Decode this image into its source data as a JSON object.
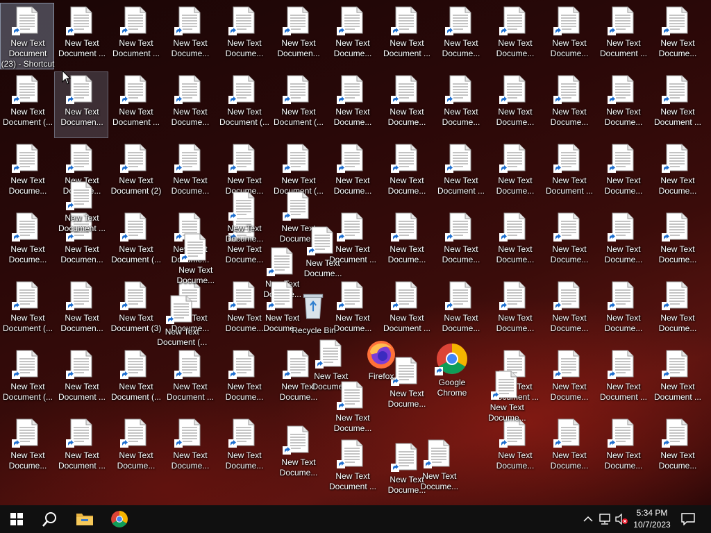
{
  "desktop": {
    "icons": [
      {
        "label": "New Text Document (23) - Shortcut",
        "col": 0,
        "row": 0,
        "selected": true
      },
      {
        "label": "New Text Document ...",
        "col": 1,
        "row": 0
      },
      {
        "label": "New Text Document ...",
        "col": 2,
        "row": 0
      },
      {
        "label": "New Text Docume...",
        "col": 3,
        "row": 0
      },
      {
        "label": "New Text Docume...",
        "col": 4,
        "row": 0
      },
      {
        "label": "New Text Documen...",
        "col": 5,
        "row": 0
      },
      {
        "label": "New Text Docume...",
        "col": 6,
        "row": 0
      },
      {
        "label": "New Text Document ...",
        "col": 7,
        "row": 0
      },
      {
        "label": "New Text Docume...",
        "col": 8,
        "row": 0
      },
      {
        "label": "New Text Docume...",
        "col": 9,
        "row": 0
      },
      {
        "label": "New Text Docume...",
        "col": 10,
        "row": 0
      },
      {
        "label": "New Text Document ...",
        "col": 11,
        "row": 0
      },
      {
        "label": "New Text Docume...",
        "col": 12,
        "row": 0
      },
      {
        "label": "New Text Document (...",
        "col": 0,
        "row": 1
      },
      {
        "label": "New Text Documen...",
        "col": 1,
        "row": 1,
        "hover": true
      },
      {
        "label": "New Text Document ...",
        "col": 2,
        "row": 1
      },
      {
        "label": "New Text Docume...",
        "col": 3,
        "row": 1
      },
      {
        "label": "New Text Document (...",
        "col": 4,
        "row": 1
      },
      {
        "label": "New Text Document (...",
        "col": 5,
        "row": 1
      },
      {
        "label": "New Text Docume...",
        "col": 6,
        "row": 1
      },
      {
        "label": "New Text Docume...",
        "col": 7,
        "row": 1
      },
      {
        "label": "New Text Docume...",
        "col": 8,
        "row": 1
      },
      {
        "label": "New Text Docume...",
        "col": 9,
        "row": 1
      },
      {
        "label": "New Text Docume...",
        "col": 10,
        "row": 1
      },
      {
        "label": "New Text Docume...",
        "col": 11,
        "row": 1
      },
      {
        "label": "New Text Document ...",
        "col": 12,
        "row": 1
      },
      {
        "label": "New Text Docume...",
        "col": 0,
        "row": 2
      },
      {
        "label": "New Text Docume...",
        "col": 1,
        "row": 2
      },
      {
        "label": "New Text Document (2)",
        "col": 2,
        "row": 2
      },
      {
        "label": "New Text Docume...",
        "col": 3,
        "row": 2
      },
      {
        "label": "New Text Docume...",
        "col": 4,
        "row": 2
      },
      {
        "label": "New Text Document (...",
        "col": 5,
        "row": 2
      },
      {
        "label": "New Text Docume...",
        "col": 6,
        "row": 2
      },
      {
        "label": "New Text Docume...",
        "col": 7,
        "row": 2
      },
      {
        "label": "New Text Document ...",
        "col": 8,
        "row": 2
      },
      {
        "label": "New Text Docume...",
        "col": 9,
        "row": 2
      },
      {
        "label": "New Text Document ...",
        "col": 10,
        "row": 2
      },
      {
        "label": "New Text Docume...",
        "col": 11,
        "row": 2
      },
      {
        "label": "New Text Docume...",
        "col": 12,
        "row": 2
      },
      {
        "label": "New Text Docume...",
        "col": 0,
        "row": 3
      },
      {
        "label": "New Text Documen...",
        "col": 1,
        "row": 3
      },
      {
        "label": "New Text Document (...",
        "col": 2,
        "row": 3
      },
      {
        "label": "New Text Docume...",
        "col": 3,
        "row": 3
      },
      {
        "label": "New Text Docume...",
        "col": 4,
        "row": 3
      },
      {
        "label": "New Text Document ...",
        "col": 6,
        "row": 3
      },
      {
        "label": "New Text Docume...",
        "col": 7,
        "row": 3
      },
      {
        "label": "New Text Docume...",
        "col": 8,
        "row": 3
      },
      {
        "label": "New Text Docume...",
        "col": 9,
        "row": 3
      },
      {
        "label": "New Text Docume...",
        "col": 10,
        "row": 3
      },
      {
        "label": "New Text Docume...",
        "col": 11,
        "row": 3
      },
      {
        "label": "New Text Docume...",
        "col": 12,
        "row": 3
      },
      {
        "label": "New Text Document (...",
        "col": 0,
        "row": 4
      },
      {
        "label": "New Text Documen...",
        "col": 1,
        "row": 4
      },
      {
        "label": "New Text Document (3)",
        "col": 2,
        "row": 4
      },
      {
        "label": "New Text Docume...",
        "col": 3,
        "row": 4
      },
      {
        "label": "New Text Docume...",
        "col": 4,
        "row": 4
      },
      {
        "label": "New Text Docume...",
        "col": 6,
        "row": 4
      },
      {
        "label": "New Text Document ...",
        "col": 7,
        "row": 4
      },
      {
        "label": "New Text Docume...",
        "col": 8,
        "row": 4
      },
      {
        "label": "New Text Docume...",
        "col": 9,
        "row": 4
      },
      {
        "label": "New Text Docume...",
        "col": 10,
        "row": 4
      },
      {
        "label": "New Text Docume...",
        "col": 11,
        "row": 4
      },
      {
        "label": "New Text Docume...",
        "col": 12,
        "row": 4
      },
      {
        "label": "New Text Document (...",
        "col": 0,
        "row": 5
      },
      {
        "label": "New Text Document ...",
        "col": 1,
        "row": 5
      },
      {
        "label": "New Text Document (...",
        "col": 2,
        "row": 5
      },
      {
        "label": "New Text Document ...",
        "col": 3,
        "row": 5
      },
      {
        "label": "New Text Docume...",
        "col": 4,
        "row": 5
      },
      {
        "label": "New Text Docume...",
        "col": 5,
        "row": 5
      },
      {
        "label": "New Text Document ...",
        "col": 9,
        "row": 5
      },
      {
        "label": "New Text Docume...",
        "col": 10,
        "row": 5
      },
      {
        "label": "New Text Document ...",
        "col": 11,
        "row": 5
      },
      {
        "label": "New Text Document ...",
        "col": 12,
        "row": 5
      },
      {
        "label": "New Text Docume...",
        "col": 0,
        "row": 6
      },
      {
        "label": "New Text Document ...",
        "col": 1,
        "row": 6
      },
      {
        "label": "New Text Docume...",
        "col": 2,
        "row": 6
      },
      {
        "label": "New Text Docume...",
        "col": 3,
        "row": 6
      },
      {
        "label": "New Text Docume...",
        "col": 4,
        "row": 6
      },
      {
        "label": "New Text Docume...",
        "col": 9,
        "row": 6
      },
      {
        "label": "New Text Docume...",
        "col": 10,
        "row": 6
      },
      {
        "label": "New Text Docume...",
        "col": 11,
        "row": 6
      },
      {
        "label": "New Text Docume...",
        "col": 12,
        "row": 6
      }
    ],
    "loose_icons": [
      {
        "label": "New Text Document ...",
        "col": 1.0,
        "row": 2.55
      },
      {
        "label": "New Text Docume...",
        "col": 3.1,
        "row": 3.3
      },
      {
        "label": "New Text Docume...",
        "col": 4.0,
        "row": 2.7
      },
      {
        "label": "New Text Docume...",
        "col": 5.0,
        "row": 2.7
      },
      {
        "label": "New Text Docume...",
        "col": 5.45,
        "row": 3.2
      },
      {
        "label": "New Text Docume...",
        "col": 4.7,
        "row": 3.5
      },
      {
        "label": "New Text Docume...",
        "col": 4.7,
        "row": 4.0
      },
      {
        "label": "New Text Document (...",
        "col": 2.85,
        "row": 4.2
      },
      {
        "label": "New Text Docume...",
        "col": 5.6,
        "row": 4.85
      },
      {
        "label": "New Text Docume...",
        "col": 7.0,
        "row": 5.1
      },
      {
        "label": "New Text Docume...",
        "col": 6.0,
        "row": 5.45
      },
      {
        "label": "New Text Docume...",
        "col": 8.85,
        "row": 5.3
      },
      {
        "label": "New Text Docume...",
        "col": 5.0,
        "row": 6.1
      },
      {
        "label": "New Text Document ...",
        "col": 6.0,
        "row": 6.3
      },
      {
        "label": "New Text Docume...",
        "col": 7.0,
        "row": 6.35
      },
      {
        "label": "New Text Docume...",
        "col": 7.6,
        "row": 6.3
      }
    ],
    "special": {
      "recycle_bin": {
        "label": "Recycle Bin"
      },
      "firefox": {
        "label": "Firefox"
      },
      "chrome": {
        "label": "Google Chrome"
      }
    }
  },
  "taskbar": {
    "start": "start-icon",
    "search": "search-icon",
    "explorer": "folder-icon",
    "chrome": "chrome-icon",
    "clock_time": "5:34 PM",
    "clock_date": "10/7/2023"
  },
  "colors": {
    "taskbar": "#101010",
    "accent": "#ffffff"
  }
}
